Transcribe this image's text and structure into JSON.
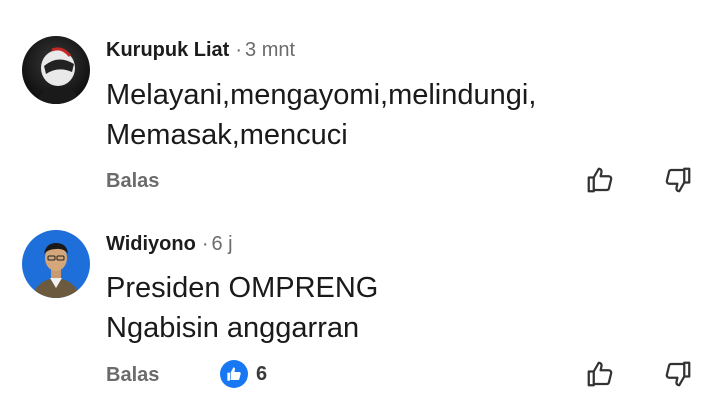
{
  "comments": [
    {
      "author": "Kurupuk Liat",
      "separator": "·",
      "time": "3 mnt",
      "lines": [
        "Melayani,mengayomi,melindungi,",
        "Memasak,mencuci"
      ],
      "reply_label": "Balas",
      "avatar_icon": "helmet-avatar-icon"
    },
    {
      "author": "Widiyono",
      "separator": "·",
      "time": "6 j",
      "lines": [
        "Presiden OMPRENG",
        "Ngabisin anggarran"
      ],
      "reply_label": "Balas",
      "like_count": "6",
      "avatar_icon": "person-avatar-icon"
    }
  ],
  "colors": {
    "like_blue": "#1877f2",
    "muted_text": "#6b6b6b"
  }
}
